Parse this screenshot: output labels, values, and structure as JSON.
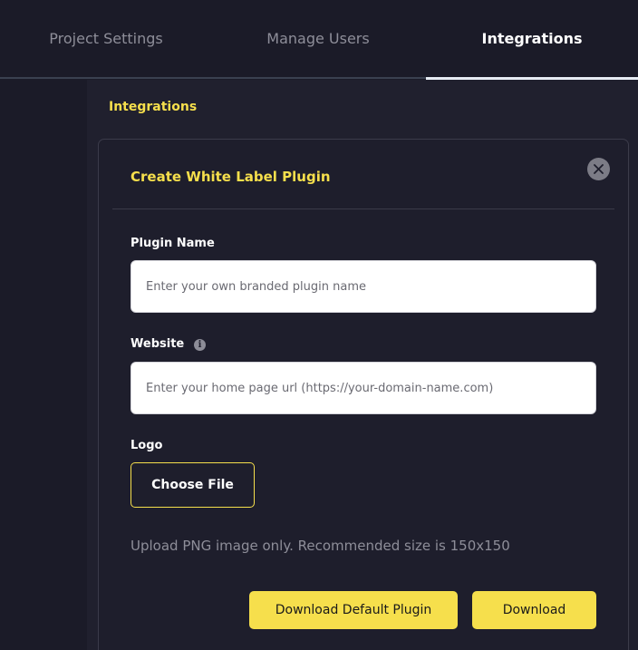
{
  "tabs": [
    {
      "label": "Project Settings",
      "active": false
    },
    {
      "label": "Manage Users",
      "active": false
    },
    {
      "label": "Integrations",
      "active": true
    }
  ],
  "section": {
    "title": "Integrations"
  },
  "modal": {
    "title": "Create White Label Plugin",
    "close_icon": "close-icon",
    "plugin_name": {
      "label": "Plugin Name",
      "value": "",
      "placeholder": "Enter your own branded plugin name"
    },
    "website": {
      "label": "Website",
      "info_icon": "info-icon",
      "value": "",
      "placeholder": "Enter your home page url (https://your-domain-name.com)"
    },
    "logo": {
      "label": "Logo",
      "button_label": "Choose File",
      "hint": "Upload PNG image only. Recommended size is 150x150"
    },
    "actions": {
      "download_default_label": "Download Default Plugin",
      "download_label": "Download"
    }
  },
  "colors": {
    "accent": "#f6df4c",
    "background": "#1e1e2c",
    "muted_text": "#8e8e99"
  }
}
